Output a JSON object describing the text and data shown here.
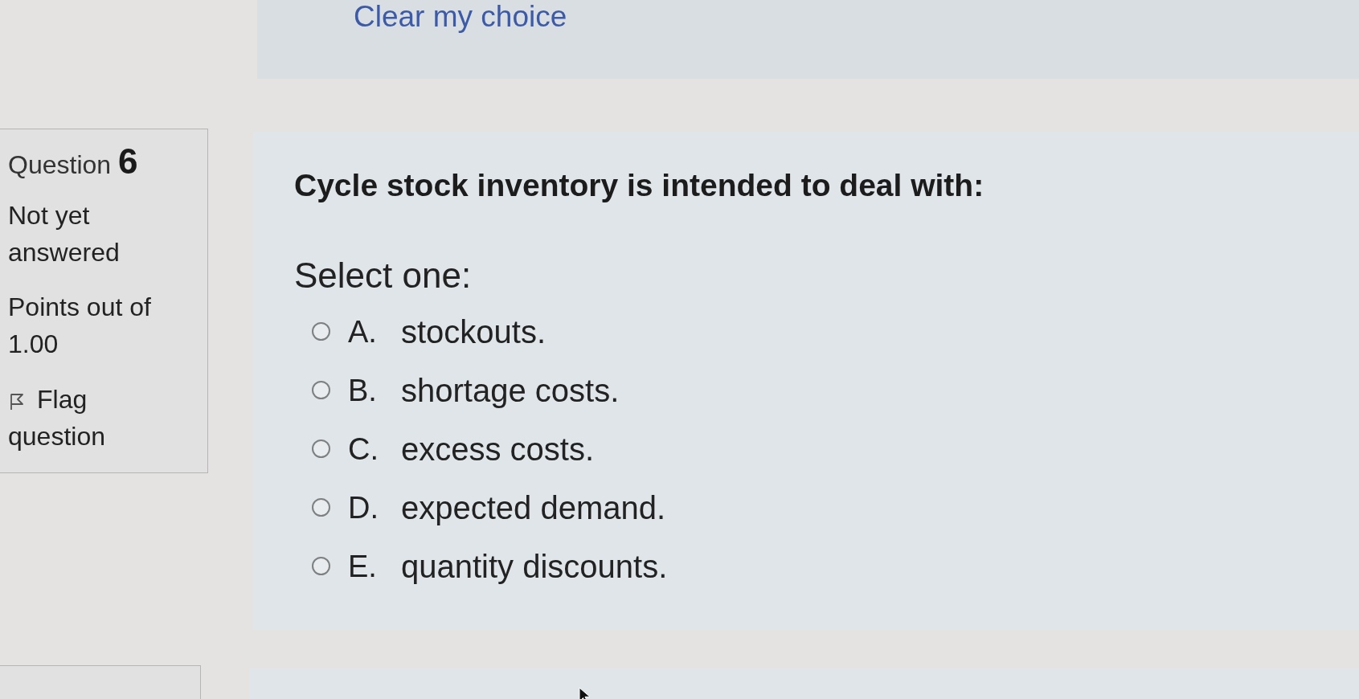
{
  "previous_question": {
    "clear_choice_link": "Clear my choice"
  },
  "question": {
    "number_label": "Question",
    "number": "6",
    "state": "Not yet answered",
    "grade": "Points out of 1.00",
    "flag_link": "Flag question",
    "text": "Cycle stock inventory is intended to deal with:",
    "prompt": "Select one:",
    "options": [
      {
        "letter": "A.",
        "text": "stockouts.",
        "selected": false
      },
      {
        "letter": "B.",
        "text": "shortage costs.",
        "selected": false
      },
      {
        "letter": "C.",
        "text": "excess costs.",
        "selected": false
      },
      {
        "letter": "D.",
        "text": "expected demand.",
        "selected": false
      },
      {
        "letter": "E.",
        "text": "quantity discounts.",
        "selected": false
      }
    ]
  }
}
